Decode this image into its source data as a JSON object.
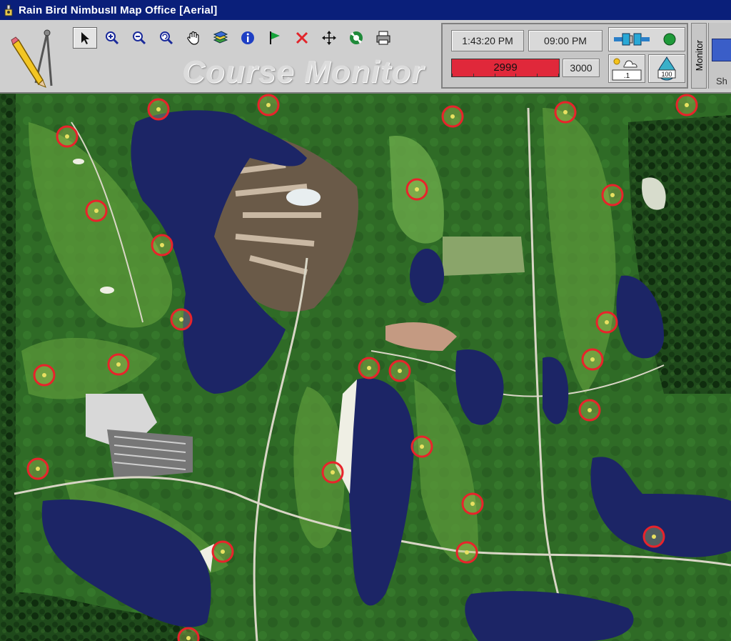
{
  "window": {
    "title": "Rain Bird NimbusII Map Office [Aerial]"
  },
  "toolbar": {
    "tools": [
      {
        "name": "select-tool",
        "icon": "arrow-pointer-icon",
        "selected": true
      },
      {
        "name": "zoom-in-tool",
        "icon": "zoom-in-icon"
      },
      {
        "name": "zoom-out-tool",
        "icon": "zoom-out-icon"
      },
      {
        "name": "zoom-extent-tool",
        "icon": "zoom-reset-icon"
      },
      {
        "name": "pan-tool",
        "icon": "hand-icon"
      },
      {
        "name": "layers-tool",
        "icon": "layers-icon"
      },
      {
        "name": "info-tool",
        "icon": "info-icon"
      },
      {
        "name": "flag-tool",
        "icon": "flag-icon"
      },
      {
        "name": "delete-tool",
        "icon": "x-icon"
      },
      {
        "name": "move-tool",
        "icon": "move-arrows-icon"
      },
      {
        "name": "sprinkler-tool",
        "icon": "sprinkler-icon"
      },
      {
        "name": "print-tool",
        "icon": "printer-icon"
      }
    ],
    "watermark": "Course Monitor"
  },
  "status": {
    "current_time": "1:43:20 PM",
    "end_time": "09:00 PM",
    "flow_value": "2999",
    "flow_capacity": "3000",
    "flow_fraction": 0.9997,
    "percent_adjust": "100",
    "weather_value": ".1"
  },
  "side": {
    "monitor_label": "Monitor",
    "right_label": "Sh"
  },
  "colors": {
    "title_bg": "#0a1f7a",
    "flow_bar": "#e0283a",
    "ring": "#e8232b",
    "water": "#1c2566",
    "turf": "#2f6b26"
  }
}
